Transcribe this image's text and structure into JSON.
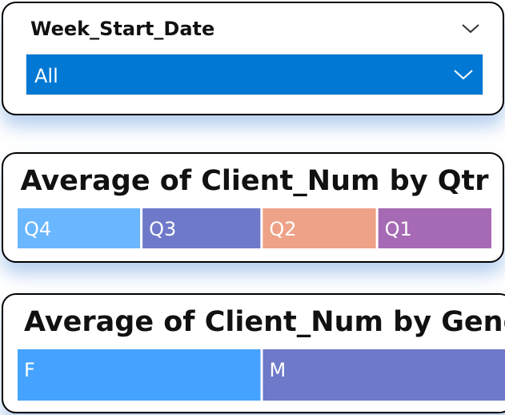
{
  "slicer": {
    "title": "Week_Start_Date",
    "selected": "All",
    "icons": {
      "header": "chevron-down-icon",
      "dropdown": "chevron-down-icon"
    },
    "accent": "#0078d4"
  },
  "charts": {
    "qtr": {
      "title": "Average of Client_Num by Qtr"
    },
    "gender": {
      "title": "Average of Client_Num by Gender"
    }
  },
  "chart_data": [
    {
      "type": "treemap",
      "title": "Average of Client_Num by Qtr",
      "categories": [
        "Q4",
        "Q3",
        "Q2",
        "Q1"
      ],
      "values": [
        26,
        25,
        24,
        24
      ],
      "colors": [
        "#6ab7ff",
        "#6e79c9",
        "#eea287",
        "#a66ab4"
      ]
    },
    {
      "type": "treemap",
      "title": "Average of Client_Num by Gender",
      "categories": [
        "F",
        "M"
      ],
      "values": [
        50,
        50
      ],
      "colors": [
        "#45a3ff",
        "#6e79c9"
      ]
    }
  ]
}
